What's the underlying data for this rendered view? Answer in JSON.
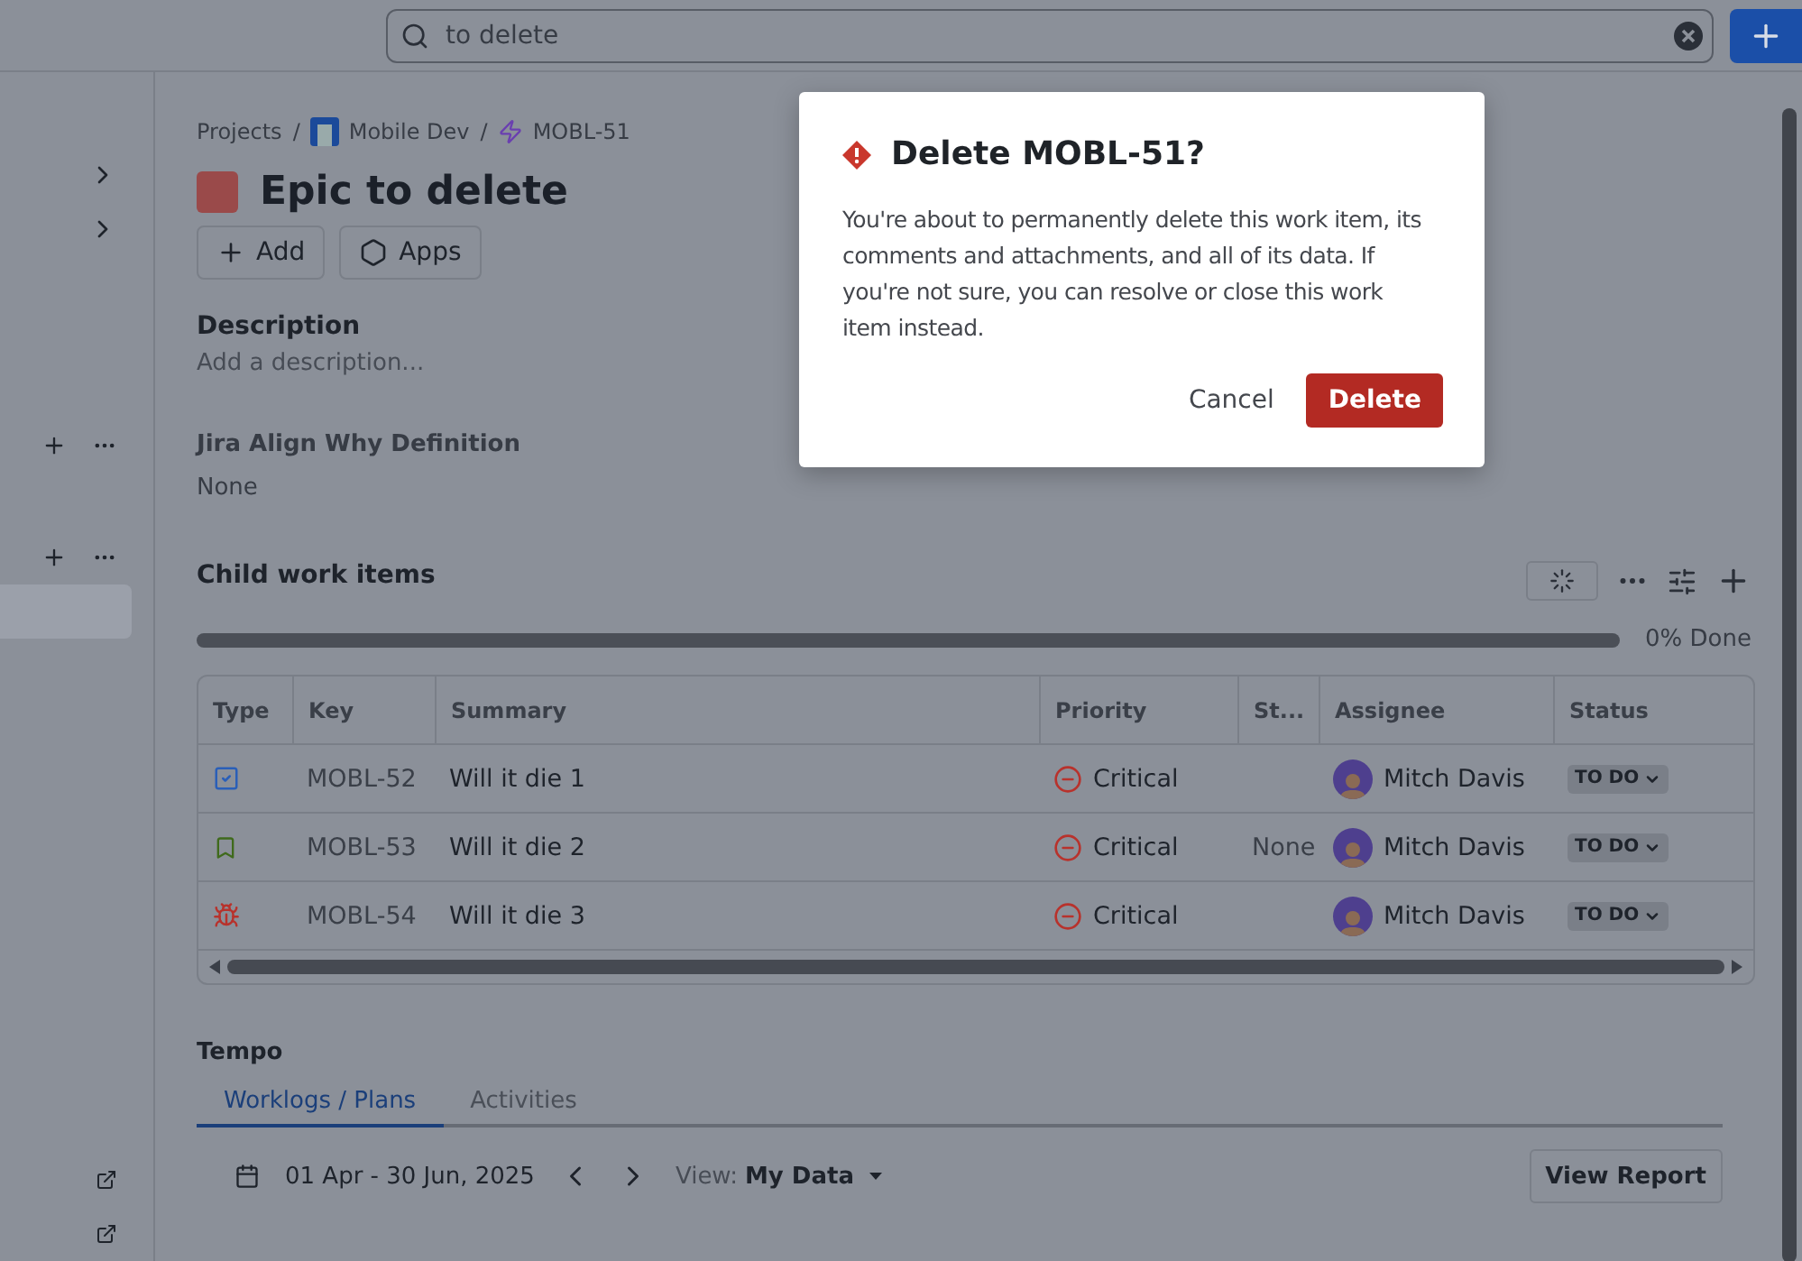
{
  "search": {
    "value": "to delete"
  },
  "breadcrumb_separator": "/",
  "breadcrumbs": [
    {
      "label": "Projects",
      "kind": "text"
    },
    {
      "label": "Mobile Dev",
      "kind": "project"
    },
    {
      "label": "MOBL-51",
      "kind": "epic"
    }
  ],
  "title": "Epic to delete",
  "actions": [
    {
      "label": "Add",
      "kind": "add"
    },
    {
      "label": "Apps",
      "kind": "apps"
    }
  ],
  "description": {
    "heading": "Description",
    "placeholder": "Add a description..."
  },
  "field": {
    "label": "Jira Align Why Definition",
    "value": "None"
  },
  "child_items": {
    "title": "Child work items",
    "progress": {
      "level": 0,
      "reading": "0% Done"
    },
    "columns": [
      "Type",
      "Key",
      "Summary",
      "Priority",
      "St...",
      "Assignee",
      "Status"
    ],
    "rows": [
      {
        "kind": "task",
        "key": "MOBL-52",
        "summary": "Will it die 1",
        "priority": "Critical",
        "assignee": "Mitch Davis",
        "status": "TO DO"
      },
      {
        "kind": "story",
        "key": "MOBL-53",
        "summary": "Will it die 2",
        "priority": "Critical",
        "column_5": "None",
        "assignee": "Mitch Davis",
        "status": "TO DO"
      },
      {
        "kind": "bug",
        "key": "MOBL-54",
        "summary": "Will it die 3",
        "priority": "Critical",
        "assignee": "Mitch Davis",
        "status": "TO DO"
      }
    ]
  },
  "tempo": {
    "title": "Tempo",
    "tabs": [
      {
        "label": "Worklogs / Plans",
        "selected": true
      },
      {
        "label": "Activities",
        "selected": false
      }
    ],
    "date_range": "01 Apr - 30 Jun, 2025",
    "view_label": "View:",
    "view_value": "My Data",
    "button": "View Report"
  },
  "dialog": {
    "title": "Delete MOBL-51?",
    "body": "You're about to permanently delete this work item, its comments and attachments, and all of its data. If you're not sure, you can resolve or close this work item instead.",
    "cancel": "Cancel",
    "confirm": "Delete"
  }
}
